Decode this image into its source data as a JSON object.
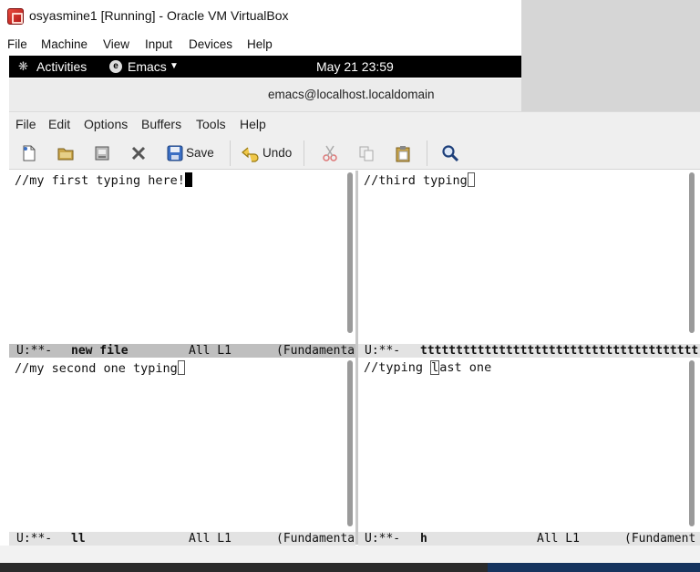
{
  "vbox": {
    "title": "osyasmine1 [Running] - Oracle VM VirtualBox",
    "menu": [
      "File",
      "Machine",
      "View",
      "Input",
      "Devices",
      "Help"
    ]
  },
  "gnome": {
    "activities": "Activities",
    "app": "Emacs",
    "clock": "May 21  23:59"
  },
  "emacs": {
    "title": "emacs@localhost.localdomain",
    "menu": [
      "File",
      "Edit",
      "Options",
      "Buffers",
      "Tools",
      "Help"
    ],
    "toolbar": {
      "save_label": "Save",
      "undo_label": "Undo"
    },
    "windows": {
      "top_left": {
        "text": "//my first typing here!",
        "modeline": {
          "flags": "U:**-",
          "buffer": "new file",
          "position": "All L1",
          "mode": "(Fundamenta"
        }
      },
      "top_right": {
        "text": "//third typing",
        "modeline": {
          "flags": "U:**-",
          "buffer": "ttttttttttttttttttttttttttttttttttttttt",
          "position": "",
          "mode": ""
        }
      },
      "bottom_left": {
        "text": "//my second one typing",
        "modeline": {
          "flags": "U:**-",
          "buffer": "ll",
          "position": "All L1",
          "mode": "(Fundamenta"
        }
      },
      "bottom_right": {
        "text_before": "//typing ",
        "text_cursor": "l",
        "text_after": "ast one",
        "modeline": {
          "flags": "U:**-",
          "buffer": "h",
          "position": "All L1",
          "mode": "(Fundament"
        }
      }
    }
  },
  "colors": {
    "modeline_active": "#bfbfbf",
    "modeline_inactive": "#e3e3e3",
    "gnome_bar": "#000000"
  },
  "icons": [
    "virtualbox-logo-icon",
    "activities-icon",
    "emacs-app-icon",
    "chevron-down-icon",
    "new-file-icon",
    "open-folder-icon",
    "save-disk-icon",
    "close-x-icon",
    "undo-arrow-icon",
    "cut-scissors-icon",
    "copy-icon",
    "paste-clipboard-icon",
    "search-magnifier-icon"
  ]
}
